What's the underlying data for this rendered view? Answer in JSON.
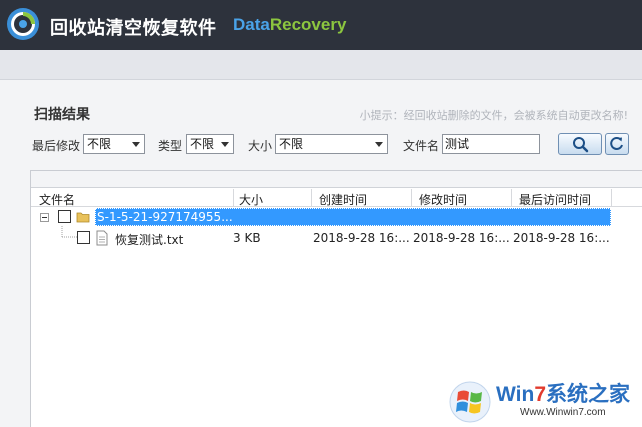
{
  "app": {
    "title": "回收站清空恢复软件",
    "brand_part1": "Data",
    "brand_part2": "Recovery"
  },
  "section": {
    "title": "扫描结果",
    "tip": "小提示：经回收站删除的文件，会被系统自动更改名称!"
  },
  "filters": {
    "modified_label": "最后修改",
    "modified_value": "不限",
    "type_label": "类型",
    "type_value": "不限",
    "size_label": "大小",
    "size_value": "不限",
    "filename_label": "文件名",
    "filename_value": "测试"
  },
  "icons": {
    "search": "search-icon",
    "refresh": "refresh-icon",
    "folder": "folder-icon",
    "file": "text-file-icon",
    "logo": "app-logo-icon"
  },
  "table": {
    "columns": [
      "文件名",
      "大小",
      "创建时间",
      "修改时间",
      "最后访问时间"
    ],
    "rows": [
      {
        "name": "S-1-5-21-927174955...",
        "size": "",
        "created": "",
        "modified": "",
        "accessed": ""
      },
      {
        "name": "恢复测试.txt",
        "size": "3 KB",
        "created": "2018-9-28 16:...",
        "modified": "2018-9-28 16:...",
        "accessed": "2018-9-28 16:..."
      }
    ]
  },
  "watermark": {
    "brand_win": "Win",
    "brand_seven": "7",
    "brand_rest": "系统之家",
    "url": "Www.Winwin7.com"
  },
  "colors": {
    "titlebar": "#2d323c",
    "selection": "#3399ff",
    "brand_blue": "#4aa3e8",
    "brand_green": "#8cc63f"
  }
}
